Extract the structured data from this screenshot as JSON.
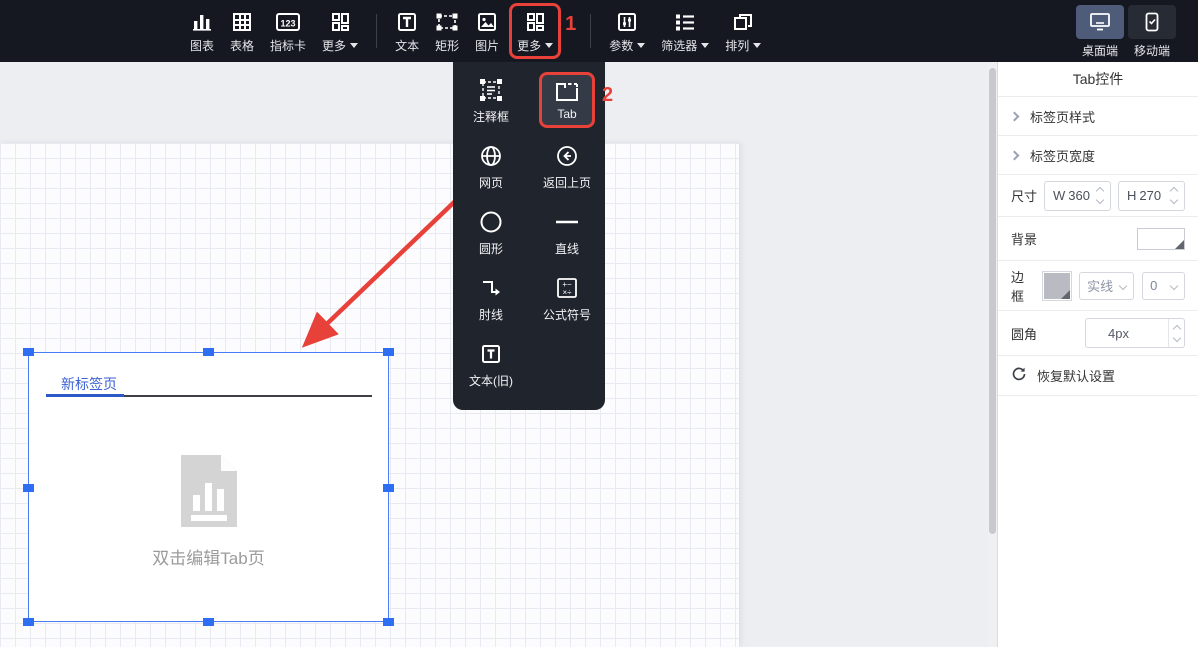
{
  "toolbar": {
    "items": [
      {
        "label": "图表"
      },
      {
        "label": "表格"
      },
      {
        "label": "指标卡"
      },
      {
        "label": "更多"
      },
      {
        "label": "文本"
      },
      {
        "label": "矩形"
      },
      {
        "label": "图片"
      },
      {
        "label": "更多"
      },
      {
        "label": "参数"
      },
      {
        "label": "筛选器"
      },
      {
        "label": "排列"
      }
    ],
    "device": {
      "desktop": "桌面端",
      "mobile": "移动端"
    }
  },
  "annotations": {
    "step1": "1",
    "step2": "2"
  },
  "menu": {
    "items": [
      {
        "label": "注释框"
      },
      {
        "label": "Tab"
      },
      {
        "label": "网页"
      },
      {
        "label": "返回上页"
      },
      {
        "label": "圆形"
      },
      {
        "label": "直线"
      },
      {
        "label": "肘线"
      },
      {
        "label": "公式符号"
      },
      {
        "label": "文本(旧)"
      }
    ]
  },
  "widget": {
    "tab_label": "新标签页",
    "placeholder": "双击编辑Tab页"
  },
  "sidebar": {
    "title": "Tab控件",
    "section_style": "标签页样式",
    "section_width": "标签页宽度",
    "size_label": "尺寸",
    "size_w_prefix": "W",
    "size_w_value": "360",
    "size_h_prefix": "H",
    "size_h_value": "270",
    "background_label": "背景",
    "border_label": "边框",
    "border_style_value": "实线",
    "border_width_value": "0",
    "radius_label": "圆角",
    "radius_value": "4px",
    "reset_label": "恢复默认设置"
  },
  "colors": {
    "accent_red": "#e7413a",
    "accent_blue": "#2e6ef2",
    "toolbar_bg": "#151821"
  }
}
